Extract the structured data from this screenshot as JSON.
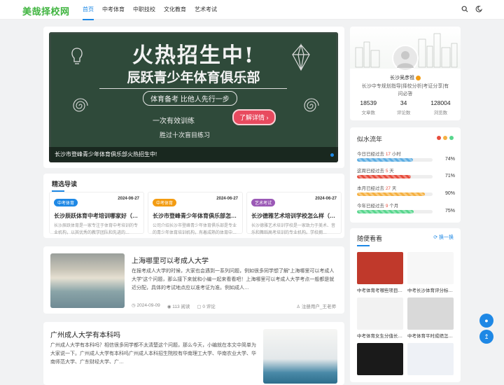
{
  "header": {
    "logo": "美哉择校网",
    "nav": [
      "首页",
      "中考体育",
      "中职技校",
      "文化教育",
      "艺术考试"
    ]
  },
  "banner": {
    "title": "火热招生中!",
    "subtitle": "辰跃青少年体育俱乐部",
    "tag": "体育备考 比他人先行一步",
    "hand1": "一次有效训练",
    "hand2": "胜过十次盲目练习",
    "cta": "了解详情",
    "caption": "长沙市登峰青少年体育俱乐部火热招生中!"
  },
  "featured": {
    "title": "精选导读",
    "items": [
      {
        "badge": "中考体育",
        "badge_color": "#1e88e5",
        "date": "2024-06-27",
        "title": "长沙辰跃体育中考培训哪家好（…",
        "excerpt": "长沙辰跃体育是一家专注于体育中考培训的专业机构，以其优秀的教学团队和先进的…"
      },
      {
        "badge": "中考体育",
        "badge_color": "#f39c12",
        "date": "2024-06-27",
        "title": "长沙市登峰青少年体育俱乐部怎么样",
        "excerpt": "公司介绍长沙市登峰青少年体育俱乐部是专业的青少年体育培训机构，有着成熟的体育中…"
      },
      {
        "badge": "艺术考试",
        "badge_color": "#9b59b6",
        "date": "2024-06-27",
        "title": "长沙德雅艺术培训学校怎么样（湖…",
        "excerpt": "长沙德雅艺术培训学校是一家致力于美术、音乐和舞蹈高考培训的专业机构。学校拥…"
      }
    ]
  },
  "posts": [
    {
      "title": "上海哪里可以考成人大学",
      "excerpt": "在报考成人大学的时候，大家也会遇到一系列问题，例如很多同学想了解“上海哪里可以考成人大学”这个问题，那么接下来就和小编一起来看看吧！上海哪里可以考成人大学考点一般都是就近分配，具体的考试地点应以准考证为准。例如成人…",
      "date": "2024-09-09",
      "views": "113 阅读",
      "comments": "0 评论",
      "author": "注册用户_王老师"
    },
    {
      "title": "广州成人大学有本科吗",
      "excerpt": "广州成人大学有本科吗？相信很多同学都不太清楚这个问题，那么今天，小编就在本文中简单为大家说一下。广州成人大学有本科吗广州成人本科招生院校有华南理工大学、华南农业大学、华南师范大学、广东财经大学、广…",
      "date": "",
      "views": "",
      "comments": "",
      "author": ""
    }
  ],
  "profile": {
    "name": "长沙吴彦祖",
    "desc": "长沙中专规划指导|择校分析|考证分享|有问必答",
    "stats": [
      {
        "num": "18539",
        "label": "文章数"
      },
      {
        "num": "34",
        "label": "评论数"
      },
      {
        "num": "128004",
        "label": "浏览数"
      }
    ]
  },
  "flow": {
    "title": "似水流年",
    "rows": [
      {
        "prefix": "今日已经过去",
        "num": "17",
        "unit": "小时",
        "pct": "74%",
        "frac": 0.74,
        "color": "#5dade2"
      },
      {
        "prefix": "这周已经过去",
        "num": "5",
        "unit": "天",
        "pct": "71%",
        "frac": 0.71,
        "color": "#e74c3c"
      },
      {
        "prefix": "本月已经过去",
        "num": "27",
        "unit": "天",
        "pct": "90%",
        "frac": 0.9,
        "color": "#f5b041"
      },
      {
        "prefix": "今年已经过去",
        "num": "9",
        "unit": "个月",
        "pct": "75%",
        "frac": 0.75,
        "color": "#58d68d"
      }
    ]
  },
  "random": {
    "title": "随便看看",
    "change": "换一换",
    "items": [
      {
        "title": "中考体育考哪些项目…",
        "bg": "#c0392b"
      },
      {
        "title": "中考长沙体育评分标…",
        "bg": "#f7f7f7"
      },
      {
        "title": "中考体育女生分值长…",
        "bg": "#f2f2f2"
      },
      {
        "title": "中考体育平时成绩怎…",
        "bg": "#d9d9d9"
      },
      {
        "title": "",
        "bg": "#1a1a1a"
      },
      {
        "title": "",
        "bg": "#eef1f6"
      }
    ]
  }
}
